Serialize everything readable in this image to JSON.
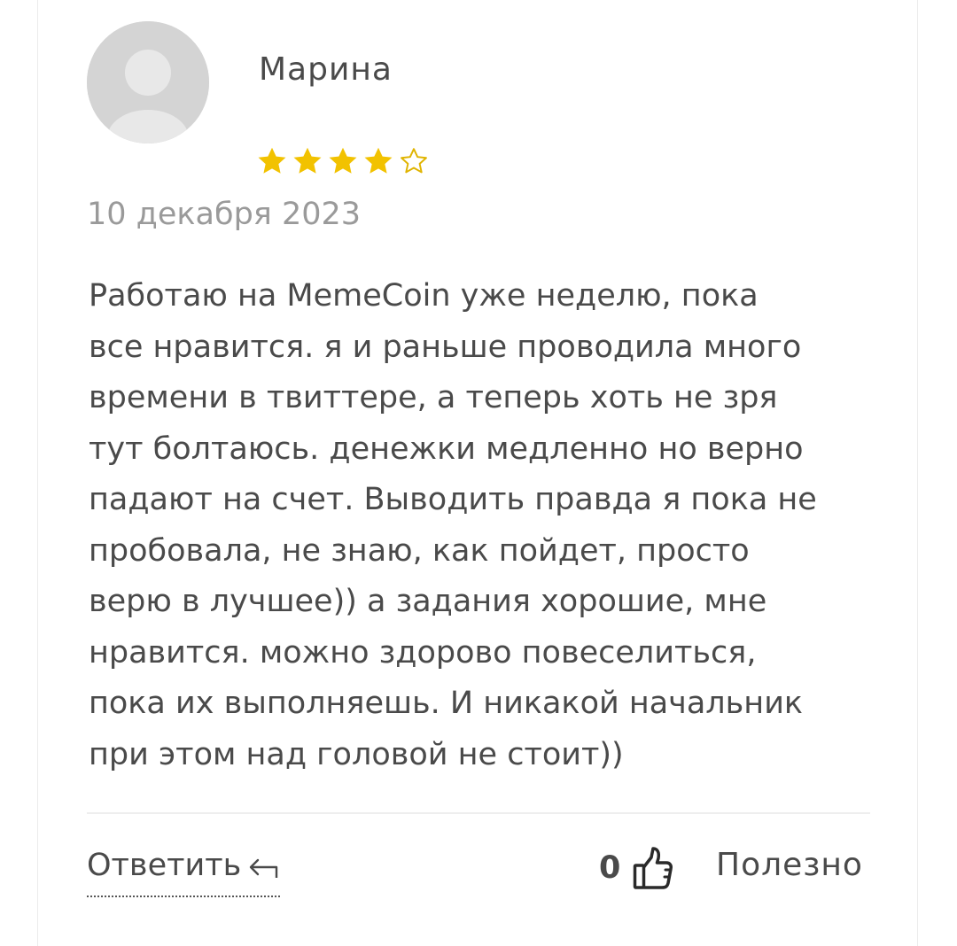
{
  "review": {
    "author": "Марина",
    "avatar_icon": "user-placeholder-icon",
    "rating": 4,
    "rating_max": 5,
    "star_color": "#f2c200",
    "date": "10 декабря 2023",
    "text": "Работаю на MemeCoin уже неделю, пока\nвсе нравится. я и раньше проводила много\nвремени в твиттере, а теперь хоть не зря\nтут болтаюсь. денежки медленно но верно\nпадают на счет. Выводить правда я пока не\nпробовала, не знаю, как пойдет, просто\nверю в лучшее)) а задания хорошие, мне\nнравится. можно здорово повеселиться,\nпока их выполняешь. И никакой начальник\nпри этом над головой не стоит))"
  },
  "actions": {
    "reply_label": "Ответить",
    "reply_icon": "reply-arrow-icon",
    "like_count": "0",
    "like_icon": "thumbs-up-icon",
    "useful_label": "Полезно"
  }
}
